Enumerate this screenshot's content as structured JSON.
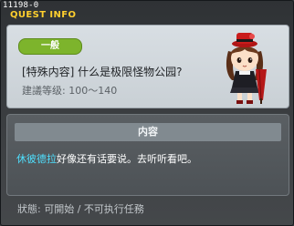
{
  "window": {
    "quest_id": "11198-0",
    "title": "QUEST INFO"
  },
  "quest": {
    "category": "一般",
    "name": "[特殊内容] 什么是极限怪物公园?",
    "level_requirement": "建議等级: 100～140"
  },
  "content": {
    "header": "内容",
    "npc_name": "休彼德拉",
    "text_after_npc": "好像还有话要说。去听听看吧。"
  },
  "status": {
    "text": "狀態: 可開始 / 不可执行任務"
  },
  "icons": {
    "npc": "npc-portrait-girl-with-hat-and-umbrella"
  },
  "colors": {
    "accent_title": "#ffcf2e",
    "badge_green": "#7db42c",
    "npc_link": "#4fe0ff"
  }
}
